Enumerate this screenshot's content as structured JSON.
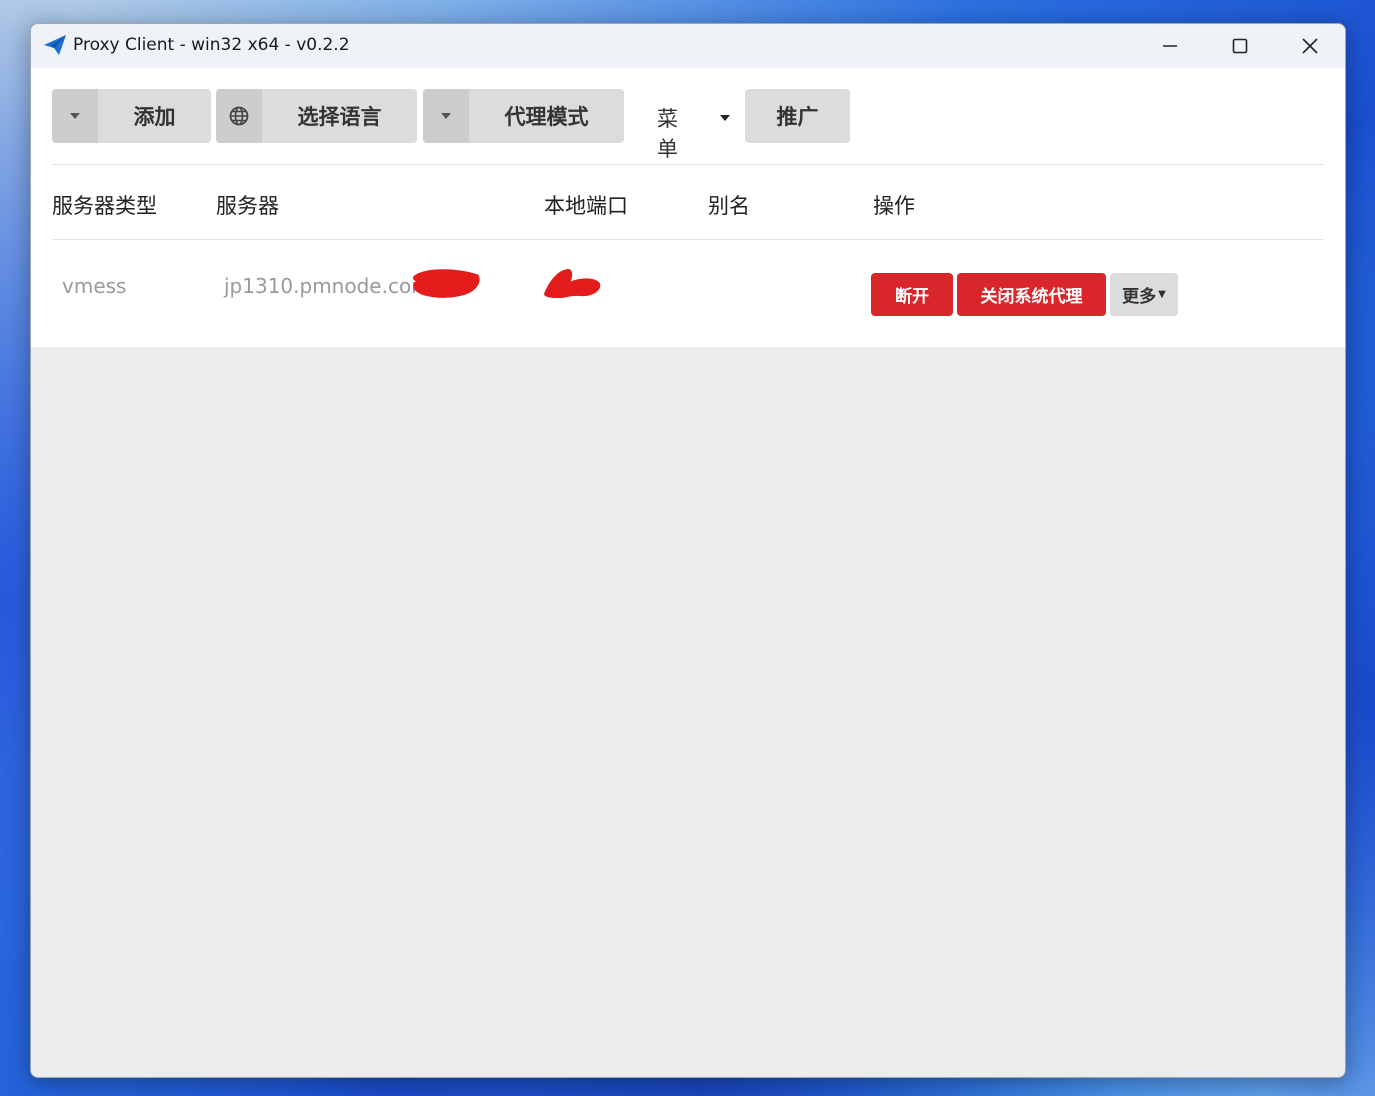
{
  "window": {
    "title": "Proxy Client - win32 x64 - v0.2.2"
  },
  "toolbar": {
    "add_label": "添加",
    "language_label": "选择语言",
    "proxy_mode_label": "代理模式",
    "menu_label": "菜单",
    "promote_label": "推广"
  },
  "table": {
    "headers": [
      "服务器类型",
      "服务器",
      "本地端口",
      "别名",
      "操作"
    ],
    "rows": [
      {
        "type": "vmess",
        "server": "jp1310.pmnode.com",
        "port": "",
        "alias": "",
        "actions": {
          "disconnect": "断开",
          "close_system_proxy": "关闭系统代理",
          "more": "更多"
        }
      }
    ]
  },
  "colors": {
    "danger": "#d9262b",
    "button_gray": "#dcdcdc",
    "app_icon_blue": "#1a6fd0"
  }
}
